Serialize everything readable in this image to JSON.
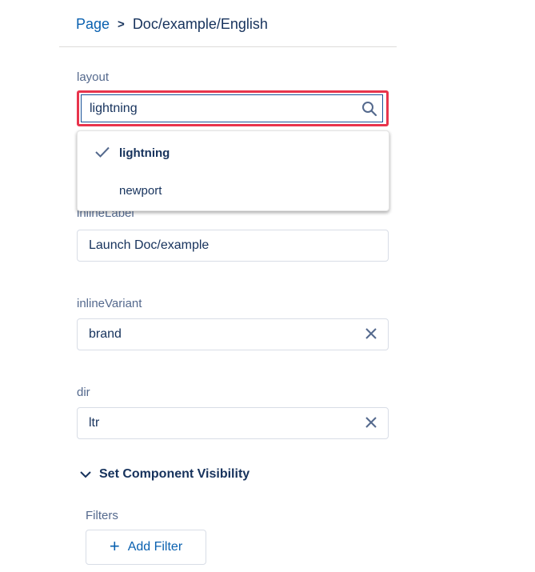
{
  "breadcrumb": {
    "root": "Page",
    "separator": ">",
    "current": "Doc/example/English"
  },
  "fields": {
    "layout": {
      "label": "layout",
      "value": "lightning",
      "options": [
        {
          "label": "lightning",
          "selected": true
        },
        {
          "label": "newport",
          "selected": false
        }
      ]
    },
    "inlineLabel": {
      "label": "inlineLabel",
      "value": "Launch Doc/example"
    },
    "inlineVariant": {
      "label": "inlineVariant",
      "value": "brand"
    },
    "dir": {
      "label": "dir",
      "value": "ltr"
    }
  },
  "visibility": {
    "title": "Set Component Visibility",
    "filters_label": "Filters",
    "add_filter_label": "Add Filter"
  },
  "colors": {
    "highlight": "#e8344c",
    "link": "#0a61b0",
    "text_dark": "#16325c"
  },
  "icons": [
    "search-icon",
    "check-icon",
    "clear-icon",
    "chevron-down-icon",
    "plus-icon"
  ]
}
